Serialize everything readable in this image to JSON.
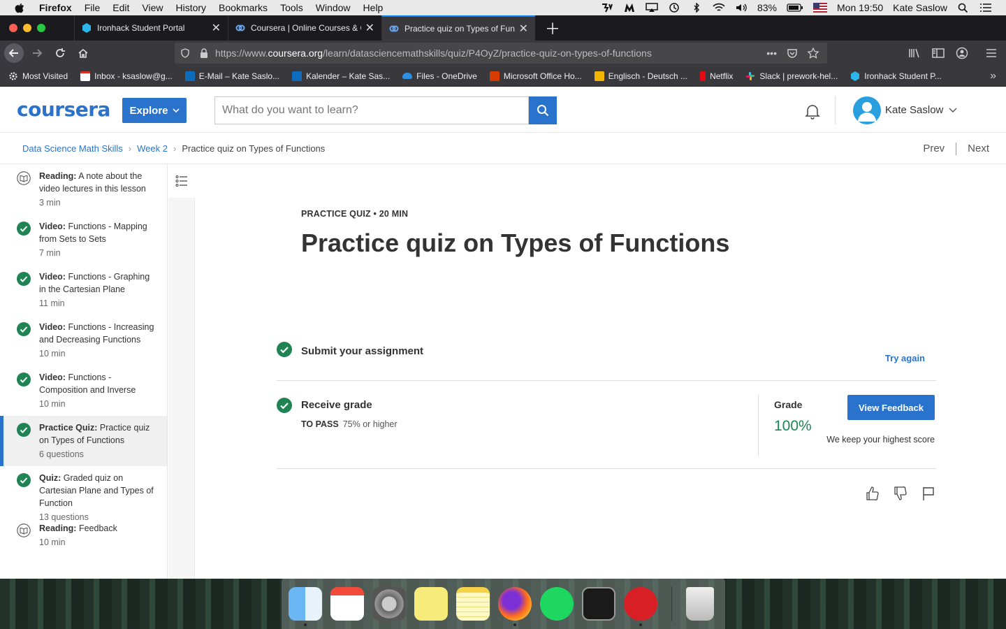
{
  "menubar": {
    "app": "Firefox",
    "items": [
      "File",
      "Edit",
      "View",
      "History",
      "Bookmarks",
      "Tools",
      "Window",
      "Help"
    ],
    "battery": "83%",
    "clock": "Mon 19:50",
    "user": "Kate Saslow"
  },
  "tabs": [
    {
      "title": "Ironhack Student Portal",
      "icon": "ironhack-icon"
    },
    {
      "title": "Coursera | Online Courses & Cr",
      "icon": "coursera-icon"
    },
    {
      "title": "Practice quiz on Types of Funct",
      "icon": "coursera-icon",
      "active": true
    }
  ],
  "urlbar": {
    "prefix": "https://www.",
    "domain": "coursera.org",
    "path": "/learn/datasciencemathskills/quiz/P4OyZ/practice-quiz-on-types-of-functions"
  },
  "bookmarks": [
    {
      "label": "Most Visited",
      "color": "#ffffff"
    },
    {
      "label": "Inbox - ksaslow@g...",
      "color": "#d93025"
    },
    {
      "label": "E-Mail – Kate Saslo...",
      "color": "#0f6cbd"
    },
    {
      "label": "Kalender – Kate Sas...",
      "color": "#0f6cbd"
    },
    {
      "label": "Files - OneDrive",
      "color": "#2f8fe0"
    },
    {
      "label": "Microsoft Office Ho...",
      "color": "#d83b01"
    },
    {
      "label": "Englisch - Deutsch ...",
      "color": "#f2b600"
    },
    {
      "label": "Netflix",
      "color": "#e50914"
    },
    {
      "label": "Slack | prework-hel...",
      "color": "#4a154b"
    },
    {
      "label": "Ironhack Student P...",
      "color": "#2bb5e8"
    }
  ],
  "header": {
    "logo": "coursera",
    "explore": "Explore",
    "search_placeholder": "What do you want to learn?",
    "user": "Kate Saslow"
  },
  "breadcrumb": {
    "course": "Data Science Math Skills",
    "week": "Week 2",
    "current": "Practice quiz on Types of Functions",
    "prev": "Prev",
    "next": "Next"
  },
  "sidebar": [
    {
      "type": "Reading:",
      "title": "A note about the video lectures in this lesson",
      "meta": "3 min",
      "status": "reading"
    },
    {
      "type": "Video:",
      "title": "Functions - Mapping from Sets to Sets",
      "meta": "7 min",
      "status": "done"
    },
    {
      "type": "Video:",
      "title": "Functions - Graphing in the Cartesian Plane",
      "meta": "11 min",
      "status": "done"
    },
    {
      "type": "Video:",
      "title": "Functions - Increasing and Decreasing Functions",
      "meta": "10 min",
      "status": "done"
    },
    {
      "type": "Video:",
      "title": "Functions - Composition and Inverse",
      "meta": "10 min",
      "status": "done"
    },
    {
      "type": "Practice Quiz:",
      "title": "Practice quiz on Types of Functions",
      "meta": "6 questions",
      "status": "done",
      "active": true
    },
    {
      "type": "Quiz:",
      "title": "Graded quiz on Cartesian Plane and Types of Function",
      "meta": "13 questions",
      "status": "done"
    },
    {
      "type": "Reading:",
      "title": "Feedback",
      "meta": "10 min",
      "status": "reading"
    }
  ],
  "main": {
    "kicker": "PRACTICE QUIZ • 20 MIN",
    "title": "Practice quiz on Types of Functions",
    "submit_label": "Submit your assignment",
    "try_again": "Try again",
    "receive_label": "Receive grade",
    "to_pass_label": "TO PASS",
    "to_pass_value": "75% or higher",
    "grade_label": "Grade",
    "grade_value": "100%",
    "view_feedback": "View Feedback",
    "keep_note": "We keep your highest score"
  },
  "colors": {
    "brand": "#2a73cc",
    "success": "#1f8354"
  }
}
